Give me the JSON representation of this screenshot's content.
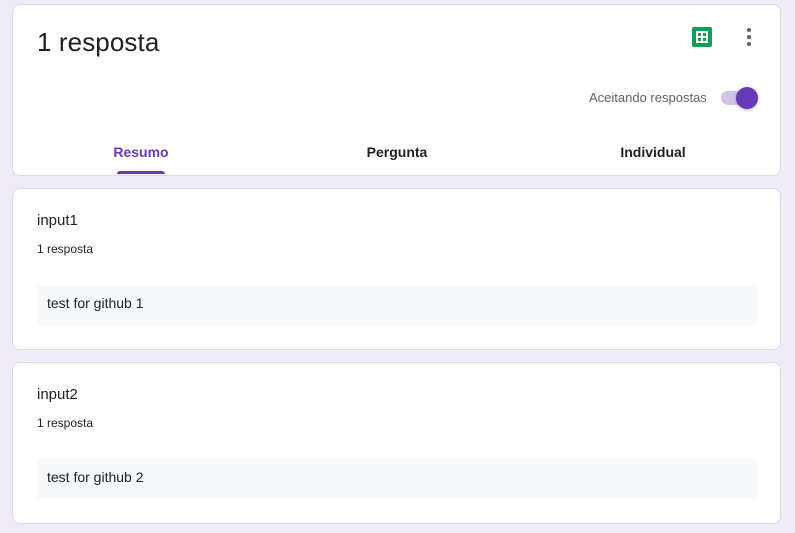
{
  "header": {
    "title": "1 resposta",
    "accepting_label": "Aceitando respostas",
    "accepting_enabled": true,
    "tabs": [
      {
        "label": "Resumo",
        "active": true
      },
      {
        "label": "Pergunta",
        "active": false
      },
      {
        "label": "Individual",
        "active": false
      }
    ],
    "icons": {
      "sheets": "google-sheets-icon",
      "more": "more-vert-icon"
    }
  },
  "questions": [
    {
      "title": "input1",
      "count": "1 resposta",
      "answers": [
        "test for github 1"
      ]
    },
    {
      "title": "input2",
      "count": "1 resposta",
      "answers": [
        "test for github 2"
      ]
    }
  ],
  "colors": {
    "accent": "#673ab7",
    "background": "#f0ebf8",
    "sheets_green": "#0f9d58"
  }
}
